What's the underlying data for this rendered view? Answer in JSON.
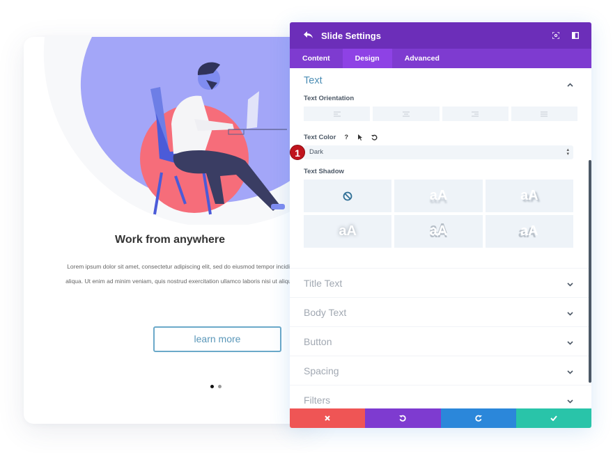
{
  "slide": {
    "title": "Work from anywhere",
    "body": "Lorem ipsum dolor sit amet, consectetur adipiscing elit, sed do eiusmod tempor incididunt ut labore et dolore magna aliqua. Ut enim ad minim veniam, quis nostrud exercitation ullamco laboris nisi ut aliquip ex ea commodo consequat..",
    "button_label": "learn more",
    "dots": [
      {
        "active": true
      },
      {
        "active": false
      }
    ]
  },
  "panel": {
    "title": "Slide Settings",
    "tabs": [
      {
        "label": "Content",
        "active": false
      },
      {
        "label": "Design",
        "active": true
      },
      {
        "label": "Advanced",
        "active": false
      }
    ],
    "text_section": {
      "title": "Text",
      "orientation_label": "Text Orientation",
      "orientation_options": [
        "left",
        "center",
        "right",
        "justify"
      ],
      "color_label": "Text Color",
      "color_value": "Dark",
      "shadow_label": "Text Shadow",
      "shadow_preview_text": "aA",
      "badge_number": "1"
    },
    "sections": [
      {
        "label": "Title Text"
      },
      {
        "label": "Body Text"
      },
      {
        "label": "Button"
      },
      {
        "label": "Spacing"
      },
      {
        "label": "Filters"
      }
    ]
  },
  "colors": {
    "header": "#6c2eb9",
    "tabs": "#7e3bd0",
    "cancel": "#ef5555",
    "undo": "#7e3bd0",
    "redo": "#2b87da",
    "save": "#29c4a9",
    "badge": "#c0141d"
  }
}
